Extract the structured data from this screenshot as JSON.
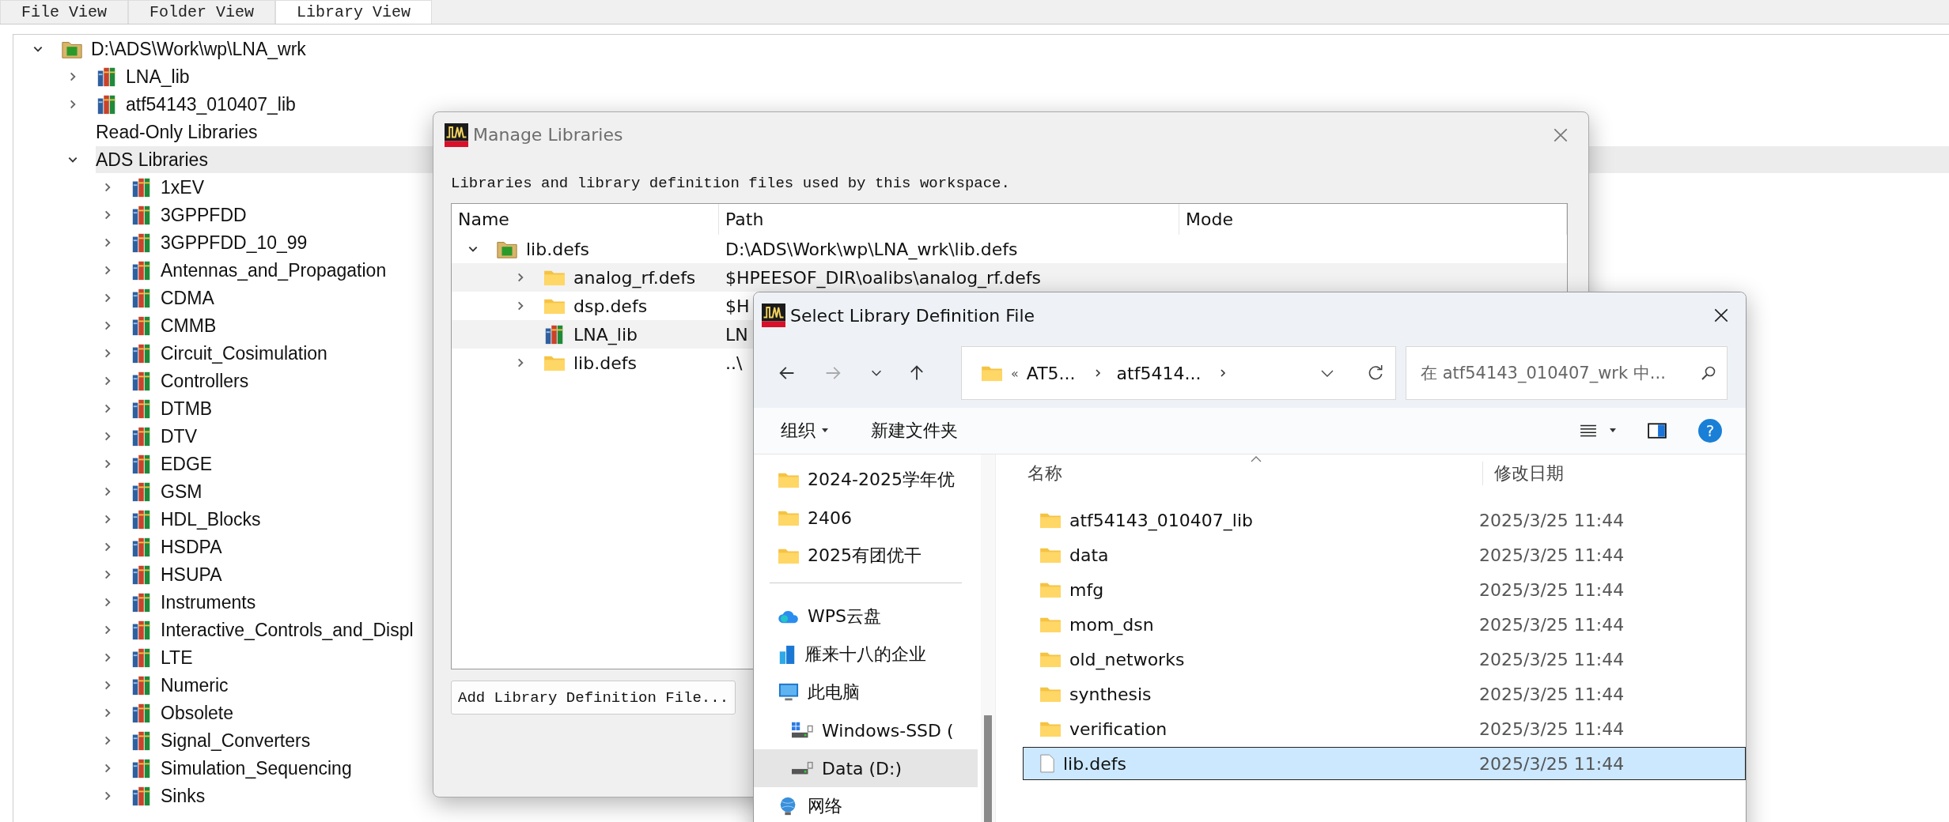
{
  "tabs": [
    {
      "label": "File View",
      "selected": false
    },
    {
      "label": "Folder View",
      "selected": false
    },
    {
      "label": "Library View",
      "selected": true
    }
  ],
  "library_tree": [
    {
      "label": "D:\\ADS\\Work\\wp\\LNA_wrk",
      "kind": "workspace",
      "expanded": true,
      "selected": false,
      "children": [
        {
          "label": "LNA_lib",
          "kind": "library",
          "expanded": false,
          "selected": false
        },
        {
          "label": "atf54143_010407_lib",
          "kind": "library",
          "expanded": false,
          "selected": false
        },
        {
          "label": "Read-Only Libraries",
          "kind": "heading",
          "selected": false
        },
        {
          "label": "ADS Libraries",
          "kind": "group",
          "expanded": true,
          "selected": true,
          "children": [
            {
              "label": "1xEV",
              "kind": "library",
              "expanded": false,
              "selected": false
            },
            {
              "label": "3GPPFDD",
              "kind": "library",
              "expanded": false,
              "selected": false
            },
            {
              "label": "3GPPFDD_10_99",
              "kind": "library",
              "expanded": false,
              "selected": false
            },
            {
              "label": "Antennas_and_Propagation",
              "kind": "library",
              "expanded": false,
              "selected": false
            },
            {
              "label": "CDMA",
              "kind": "library",
              "expanded": false,
              "selected": false
            },
            {
              "label": "CMMB",
              "kind": "library",
              "expanded": false,
              "selected": false
            },
            {
              "label": "Circuit_Cosimulation",
              "kind": "library",
              "expanded": false,
              "selected": false
            },
            {
              "label": "Controllers",
              "kind": "library",
              "expanded": false,
              "selected": false
            },
            {
              "label": "DTMB",
              "kind": "library",
              "expanded": false,
              "selected": false
            },
            {
              "label": "DTV",
              "kind": "library",
              "expanded": false,
              "selected": false
            },
            {
              "label": "EDGE",
              "kind": "library",
              "expanded": false,
              "selected": false
            },
            {
              "label": "GSM",
              "kind": "library",
              "expanded": false,
              "selected": false
            },
            {
              "label": "HDL_Blocks",
              "kind": "library",
              "expanded": false,
              "selected": false
            },
            {
              "label": "HSDPA",
              "kind": "library",
              "expanded": false,
              "selected": false
            },
            {
              "label": "HSUPA",
              "kind": "library",
              "expanded": false,
              "selected": false
            },
            {
              "label": "Instruments",
              "kind": "library",
              "expanded": false,
              "selected": false
            },
            {
              "label": "Interactive_Controls_and_Displ",
              "kind": "library",
              "expanded": false,
              "selected": false
            },
            {
              "label": "LTE",
              "kind": "library",
              "expanded": false,
              "selected": false
            },
            {
              "label": "Numeric",
              "kind": "library",
              "expanded": false,
              "selected": false
            },
            {
              "label": "Obsolete",
              "kind": "library",
              "expanded": false,
              "selected": false
            },
            {
              "label": "Signal_Converters",
              "kind": "library",
              "expanded": false,
              "selected": false
            },
            {
              "label": "Simulation_Sequencing",
              "kind": "library",
              "expanded": false,
              "selected": false
            },
            {
              "label": "Sinks",
              "kind": "library",
              "expanded": false,
              "selected": false
            }
          ]
        }
      ]
    }
  ],
  "manage_libraries": {
    "title": "Manage Libraries",
    "description": "Libraries and library definition files used by this workspace.",
    "columns": [
      "Name",
      "Path",
      "Mode"
    ],
    "rows": [
      {
        "name": "lib.defs",
        "path": "D:\\ADS\\Work\\wp\\LNA_wrk\\lib.defs",
        "kind": "workspace",
        "expanded": true,
        "children": [
          {
            "name": "analog_rf.defs",
            "path": "$HPEESOF_DIR\\oalibs\\analog_rf.defs",
            "kind": "folder",
            "expanded": false
          },
          {
            "name": "dsp.defs",
            "path": "$H",
            "kind": "folder",
            "expanded": false
          },
          {
            "name": "LNA_lib",
            "path": "LN",
            "kind": "library"
          },
          {
            "name": "lib.defs",
            "path": "..\\",
            "kind": "folder",
            "expanded": false
          }
        ]
      }
    ],
    "add_button": "Add Library Definition File..."
  },
  "select_file": {
    "title": "Select Library Definition File",
    "breadcrumb_overflow": "«",
    "breadcrumb": [
      "AT5...",
      "atf5414..."
    ],
    "search": {
      "placeholder": "在 atf54143_010407_wrk 中..."
    },
    "toolbar": {
      "organize": "组织",
      "new_folder": "新建文件夹",
      "help": "?"
    },
    "nav_pane": [
      {
        "items": [
          {
            "label": "2024-2025学年优",
            "kind": "folder",
            "selected": false
          },
          {
            "label": "2406",
            "kind": "folder",
            "selected": false
          },
          {
            "label": "2025有团优干",
            "kind": "folder",
            "selected": false
          }
        ]
      },
      {
        "items": [
          {
            "label": "WPS云盘",
            "kind": "cloud",
            "selected": false
          },
          {
            "label": "雁来十八的企业",
            "kind": "organization",
            "selected": false
          },
          {
            "label": "此电脑",
            "kind": "computer",
            "selected": false,
            "children": [
              {
                "label": "Windows-SSD (",
                "kind": "system_drive",
                "selected": false
              },
              {
                "label": "Data (D:)",
                "kind": "drive",
                "selected": true
              }
            ]
          },
          {
            "label": "网络",
            "kind": "network",
            "selected": false
          }
        ]
      }
    ],
    "columns": [
      "名称",
      "修改日期"
    ],
    "files": [
      {
        "name": "atf54143_010407_lib",
        "date": "2025/3/25 11:44",
        "kind": "folder",
        "selected": false
      },
      {
        "name": "data",
        "date": "2025/3/25 11:44",
        "kind": "folder",
        "selected": false
      },
      {
        "name": "mfg",
        "date": "2025/3/25 11:44",
        "kind": "folder",
        "selected": false
      },
      {
        "name": "mom_dsn",
        "date": "2025/3/25 11:44",
        "kind": "folder",
        "selected": false
      },
      {
        "name": "old_networks",
        "date": "2025/3/25 11:44",
        "kind": "folder",
        "selected": false
      },
      {
        "name": "synthesis",
        "date": "2025/3/25 11:44",
        "kind": "folder",
        "selected": false
      },
      {
        "name": "verification",
        "date": "2025/3/25 11:44",
        "kind": "folder",
        "selected": false
      },
      {
        "name": "lib.defs",
        "date": "2025/3/25 11:44",
        "kind": "file",
        "selected": true
      }
    ]
  }
}
